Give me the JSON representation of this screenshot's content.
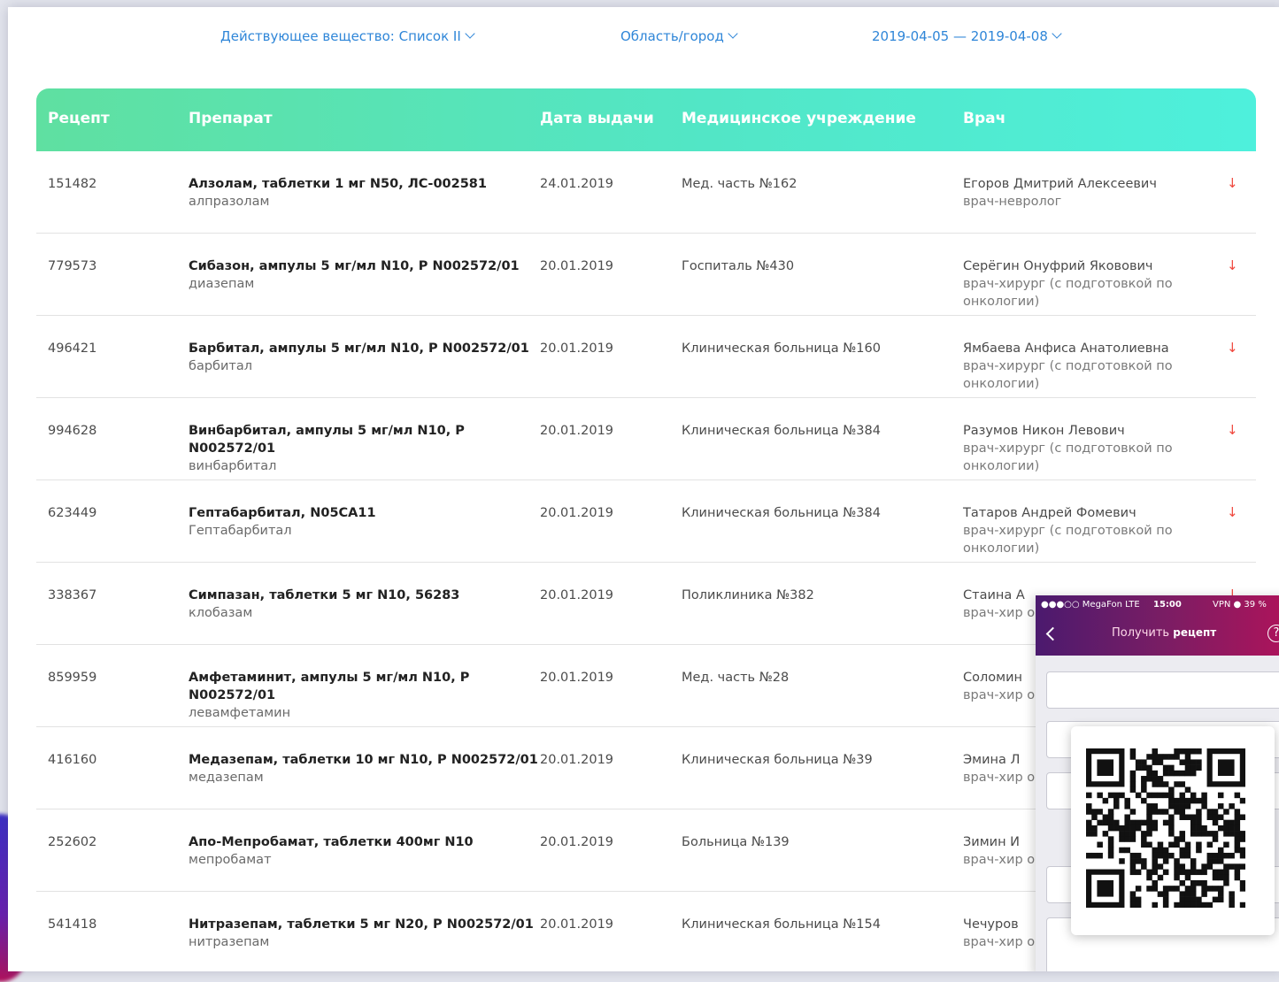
{
  "filters": {
    "substance": "Действующее вещество: Список II",
    "region": "Область/город",
    "date_range": "2019-04-05 — 2019-04-08"
  },
  "table": {
    "headers": {
      "prescription": "Рецепт",
      "drug": "Препарат",
      "issue_date": "Дата выдачи",
      "institution": "Медицинское учреждение",
      "doctor": "Врач"
    },
    "rows": [
      {
        "id": "151482",
        "drug": "Алзолам, таблетки 1 мг N50, ЛС-002581",
        "substance": "алпразолам",
        "date": "24.01.2019",
        "institution": "Мед. часть №162",
        "doctor": "Егоров Дмитрий Алексеевич",
        "specialty": "врач-невролог"
      },
      {
        "id": "779573",
        "drug": "Сибазон, ампулы 5 мг/мл N10, Р N002572/01",
        "substance": "диазепам",
        "date": "20.01.2019",
        "institution": "Госпиталь №430",
        "doctor": "Серёгин Онуфрий Яковович",
        "specialty": "врач-хирург (с подготовкой по онкологии)"
      },
      {
        "id": "496421",
        "drug": "Барбитал, ампулы 5 мг/мл N10, Р N002572/01",
        "substance": "барбитал",
        "date": "20.01.2019",
        "institution": "Клиническая больница №160",
        "doctor": "Ямбаева Анфиса Анатолиевна",
        "specialty": "врач-хирург (с подготовкой по онкологии)"
      },
      {
        "id": "994628",
        "drug": "Винбарбитал, ампулы 5 мг/мл N10, Р N002572/01",
        "substance": "винбарбитал",
        "date": "20.01.2019",
        "institution": "Клиническая больница №384",
        "doctor": "Разумов Никон Левович",
        "specialty": "врач-хирург (с подготовкой по онкологии)"
      },
      {
        "id": "623449",
        "drug": "Гептабарбитал, N05CA11",
        "substance": "Гептабарбитал",
        "date": "20.01.2019",
        "institution": "Клиническая больница №384",
        "doctor": "Татаров Андрей Фомевич",
        "specialty": "врач-хирург (с подготовкой по онкологии)"
      },
      {
        "id": "338367",
        "drug": "Симпазан, таблетки 5 мг N10, 56283",
        "substance": "клобазам",
        "date": "20.01.2019",
        "institution": "Поликлиника №382",
        "doctor": "Стаина А",
        "specialty": "врач-хир онколог"
      },
      {
        "id": "859959",
        "drug": "Амфетаминит, ампулы 5 мг/мл N10, Р N002572/01",
        "substance": "левамфетамин",
        "date": "20.01.2019",
        "institution": "Мед. часть №28",
        "doctor": "Соломин",
        "specialty": "врач-хир онколог"
      },
      {
        "id": "416160",
        "drug": "Медазепам, таблетки 10 мг N10, Р N002572/01",
        "substance": "медазепам",
        "date": "20.01.2019",
        "institution": "Клиническая больница №39",
        "doctor": "Эмина Л",
        "specialty": "врач-хир онколог"
      },
      {
        "id": "252602",
        "drug": "Апо-Мепробамат, таблетки 400мг N10",
        "substance": "мепробамат",
        "date": "20.01.2019",
        "institution": "Больница №139",
        "doctor": "Зимин И",
        "specialty": "врач-хир онколог"
      },
      {
        "id": "541418",
        "drug": "Нитразепам, таблетки 5 мг N20, Р N002572/01",
        "substance": "нитразепам",
        "date": "20.01.2019",
        "institution": "Клиническая больница №154",
        "doctor": "Чечуров",
        "specialty": "врач-хир онколог"
      }
    ]
  },
  "phone": {
    "carrier": "●●●○○ MegaFon LTE",
    "time": "15:00",
    "battery": "VPN ● 39 %",
    "title_prefix": "Получить",
    "title_bold": "рецепт",
    "help": "?"
  },
  "colors": {
    "accent_blue": "#2f86d8",
    "header_green_start": "#5fe0a1",
    "header_green_end": "#4ef0dc",
    "arrow_red": "#f0473d"
  }
}
